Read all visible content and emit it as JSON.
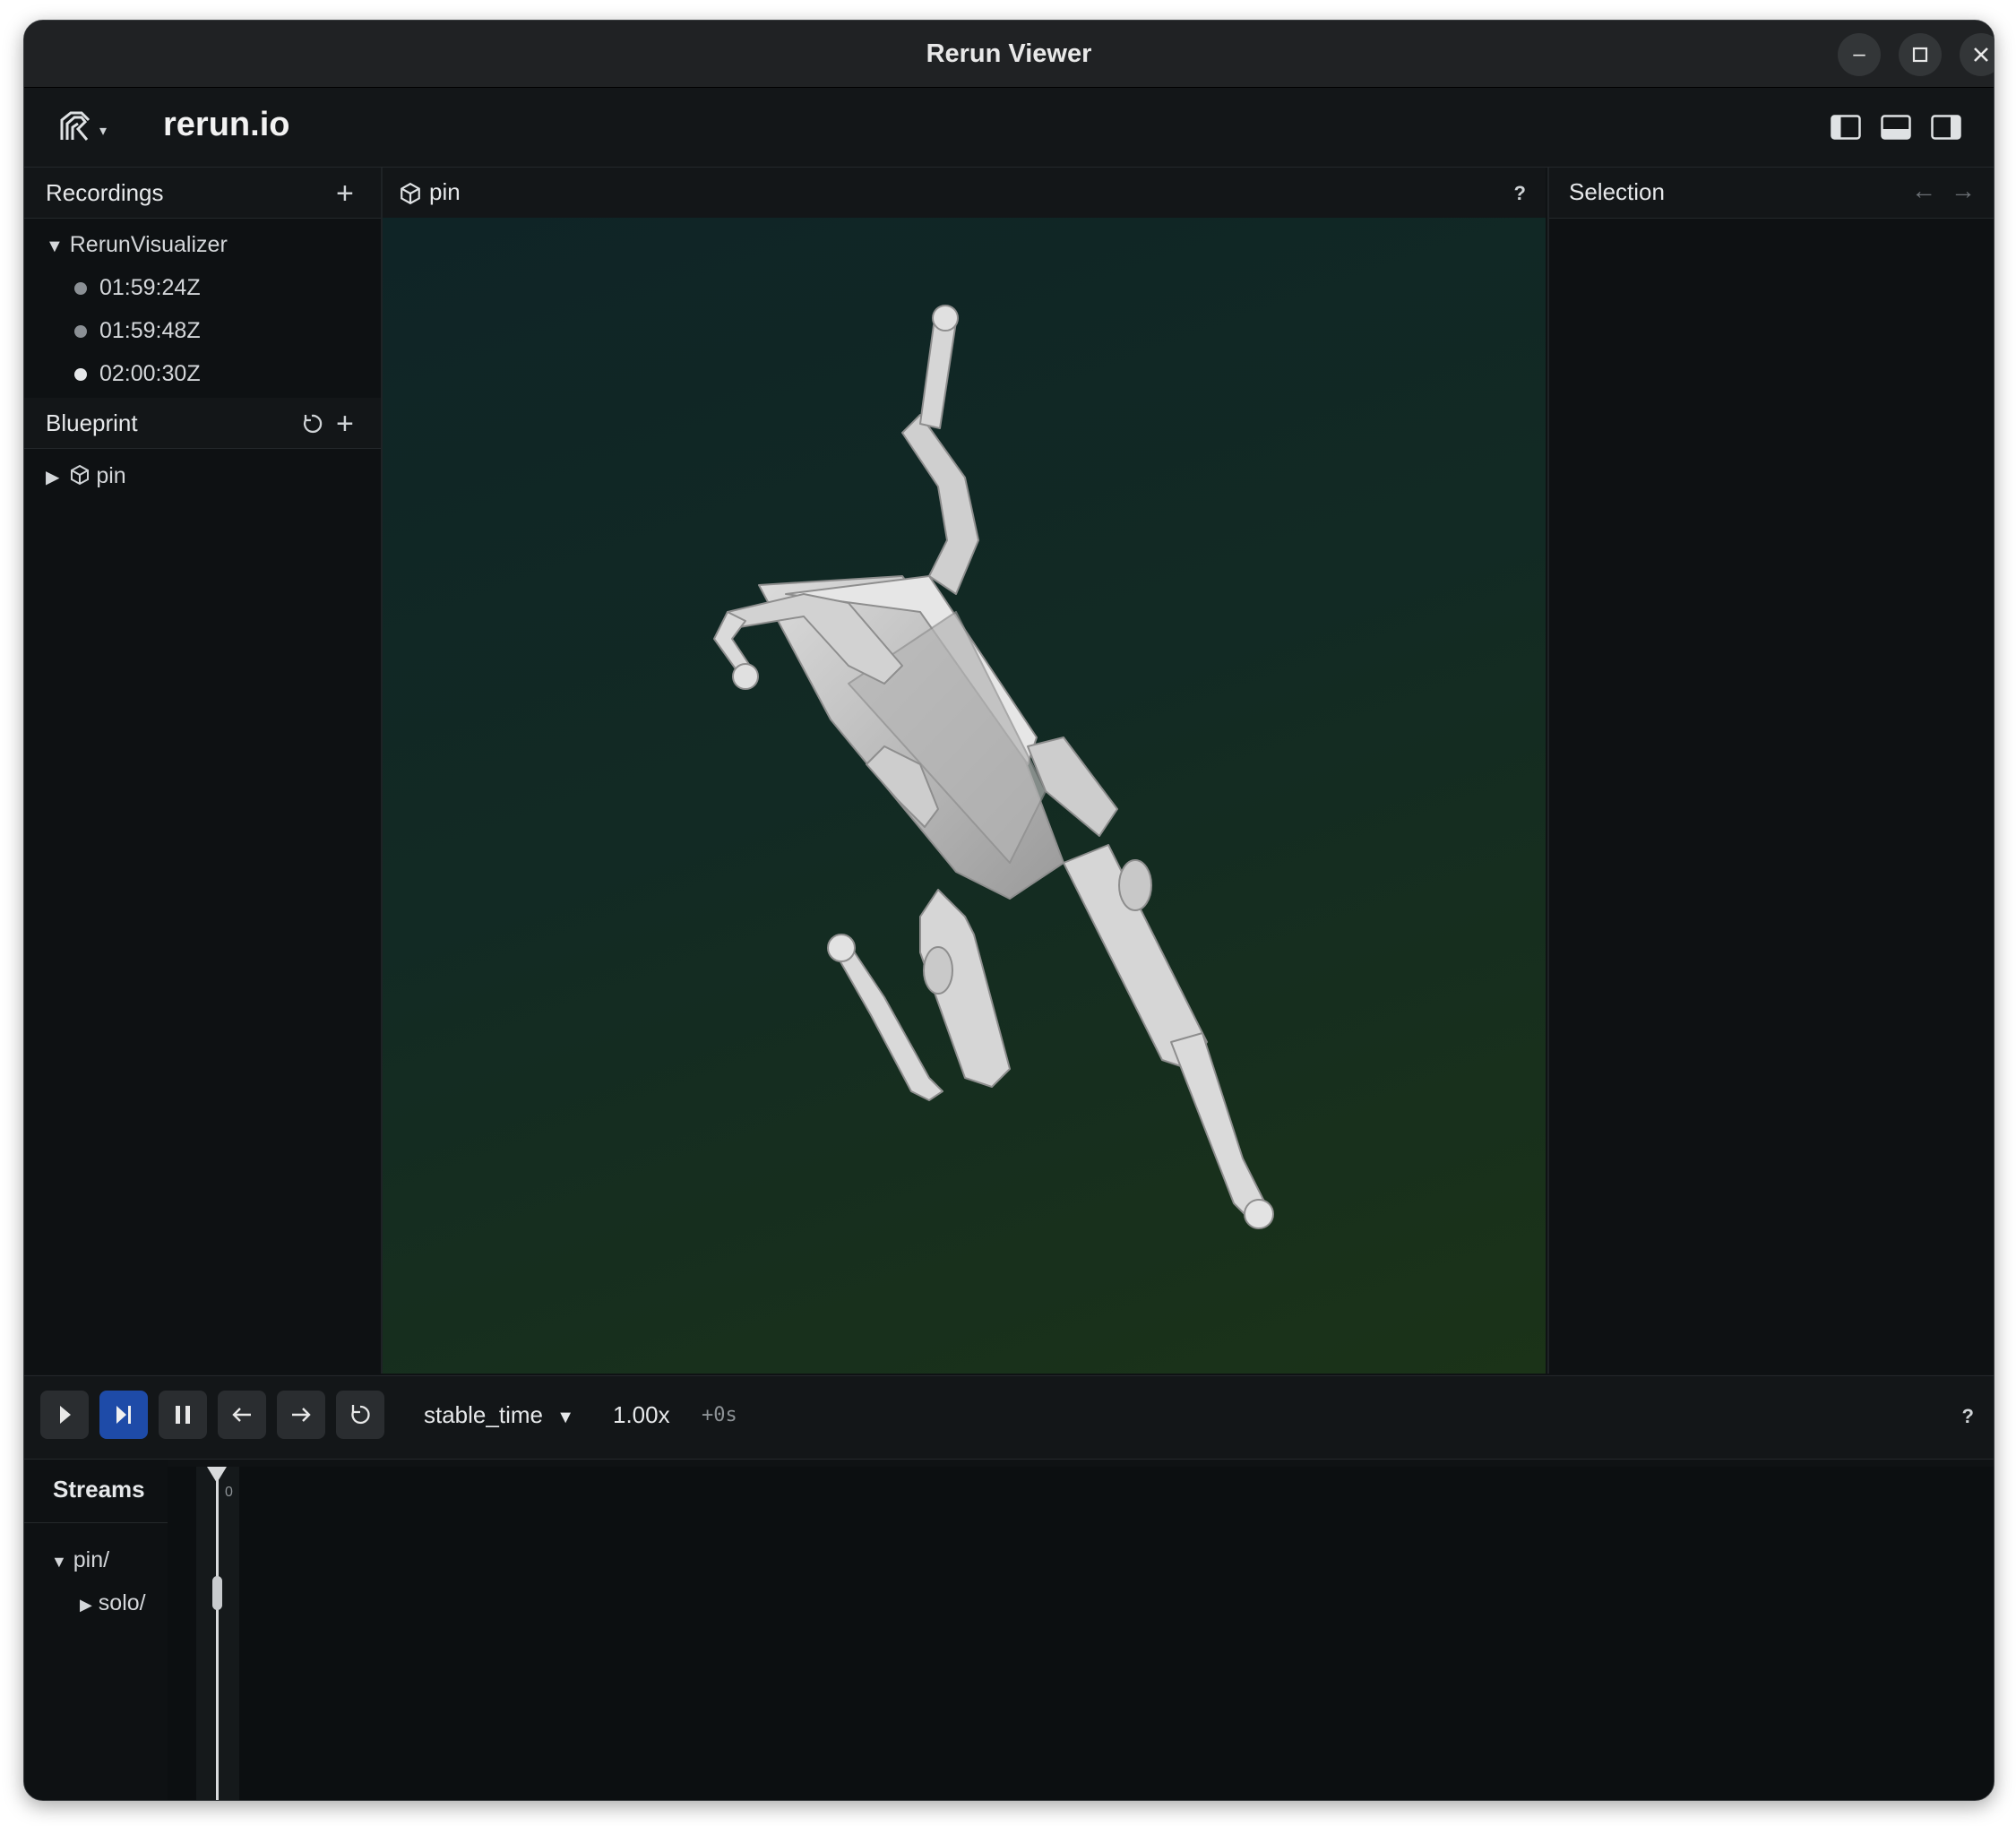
{
  "window": {
    "title": "Rerun Viewer"
  },
  "topbar": {
    "brand": "rerun.io"
  },
  "recordings": {
    "header": "Recordings",
    "app": "RerunVisualizer",
    "items": [
      {
        "label": "01:59:24Z",
        "color": "#8b9095"
      },
      {
        "label": "01:59:48Z",
        "color": "#8b9095"
      },
      {
        "label": "02:00:30Z",
        "color": "#e6e8ea"
      }
    ]
  },
  "blueprint": {
    "header": "Blueprint",
    "items": [
      {
        "label": "pin"
      }
    ]
  },
  "view": {
    "title": "pin",
    "help": "?"
  },
  "selection": {
    "header": "Selection"
  },
  "timeline": {
    "timeline_name": "stable_time",
    "speed": "1.00x",
    "offset": "+0s",
    "help": "?",
    "tick_zero": "0"
  },
  "streams": {
    "header": "Streams",
    "items": [
      {
        "label": "pin/"
      },
      {
        "label": "solo/"
      }
    ]
  },
  "colors": {
    "accent": "#1e4ba8",
    "background": "#0f1214"
  }
}
